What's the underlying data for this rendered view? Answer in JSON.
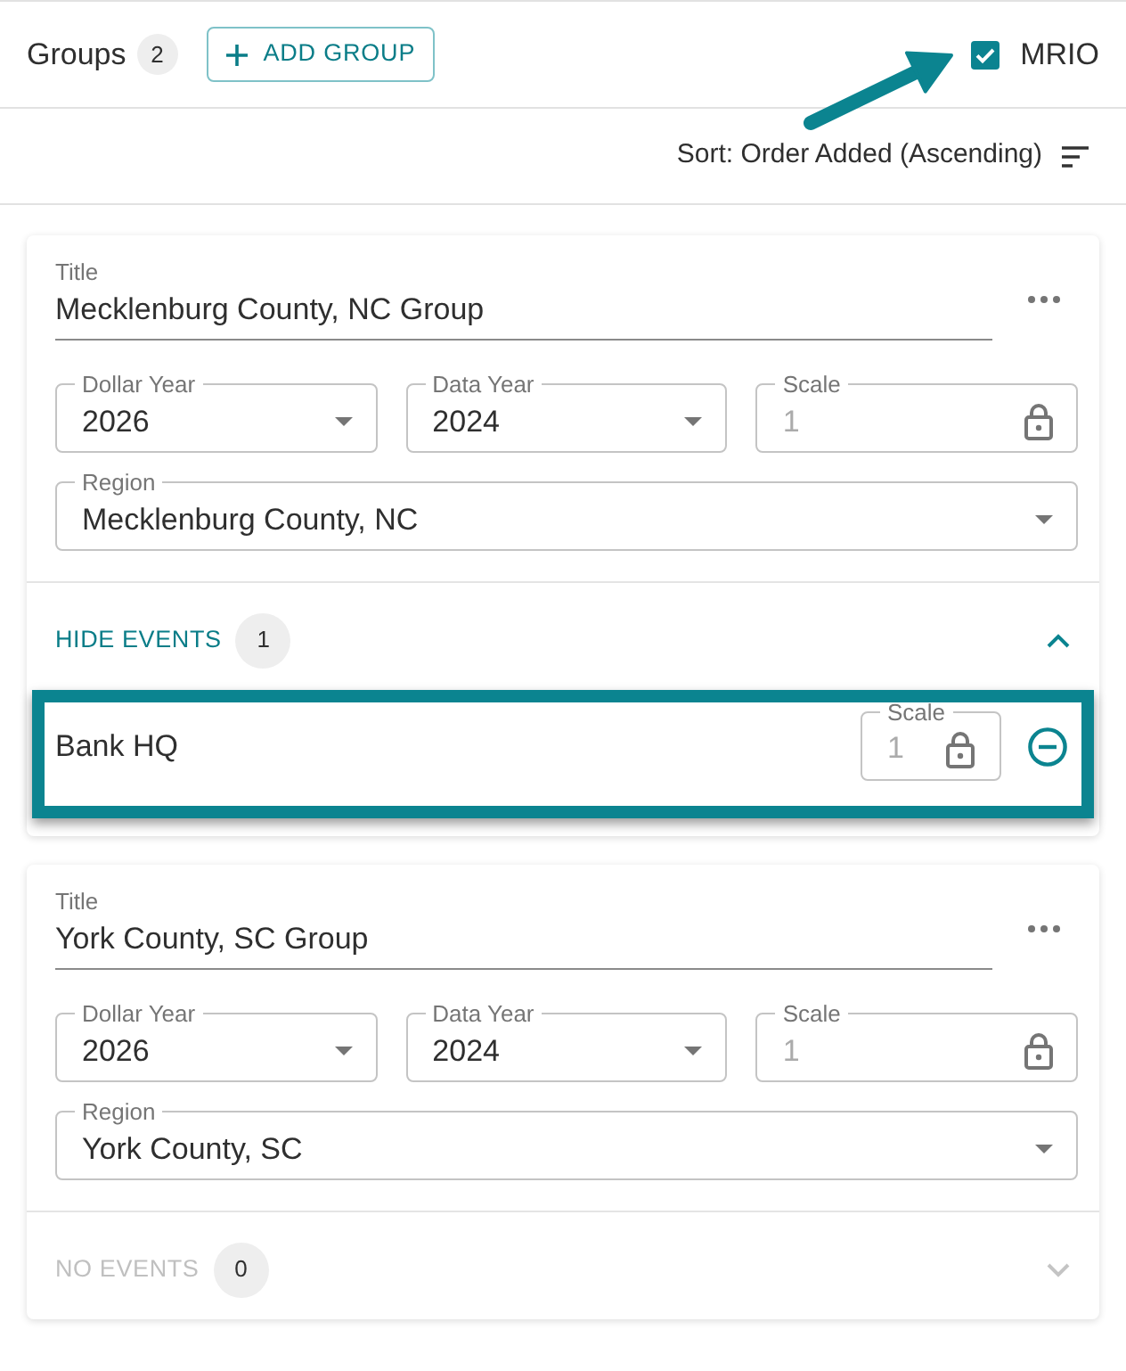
{
  "header": {
    "title": "Groups",
    "count": "2",
    "add_button": {
      "label": "ADD GROUP"
    },
    "mrio": {
      "label": "MRIO",
      "checked": true
    }
  },
  "sort": {
    "label": "Sort: Order Added (Ascending)"
  },
  "groups": [
    {
      "title": {
        "label": "Title",
        "value": "Mecklenburg County, NC Group"
      },
      "fields": [
        {
          "kind": "select",
          "label": "Dollar Year",
          "value": "2026"
        },
        {
          "kind": "select",
          "label": "Data Year",
          "value": "2024"
        },
        {
          "kind": "locked",
          "label": "Scale",
          "value": "1"
        }
      ],
      "region": {
        "kind": "select",
        "label": "Region",
        "value": "Mecklenburg County, NC"
      },
      "events_toggle": {
        "label": "HIDE EVENTS",
        "count": "1",
        "expanded": true,
        "disabled": false
      },
      "events": [
        {
          "name": "Bank HQ",
          "highlighted": true,
          "scale": {
            "kind": "locked",
            "label": "Scale",
            "value": "1"
          }
        }
      ]
    },
    {
      "title": {
        "label": "Title",
        "value": "York County, SC Group"
      },
      "fields": [
        {
          "kind": "select",
          "label": "Dollar Year",
          "value": "2026"
        },
        {
          "kind": "select",
          "label": "Data Year",
          "value": "2024"
        },
        {
          "kind": "locked",
          "label": "Scale",
          "value": "1"
        }
      ],
      "region": {
        "kind": "select",
        "label": "Region",
        "value": "York County, SC"
      },
      "events_toggle": {
        "label": "NO EVENTS",
        "count": "0",
        "expanded": false,
        "disabled": true
      }
    }
  ]
}
